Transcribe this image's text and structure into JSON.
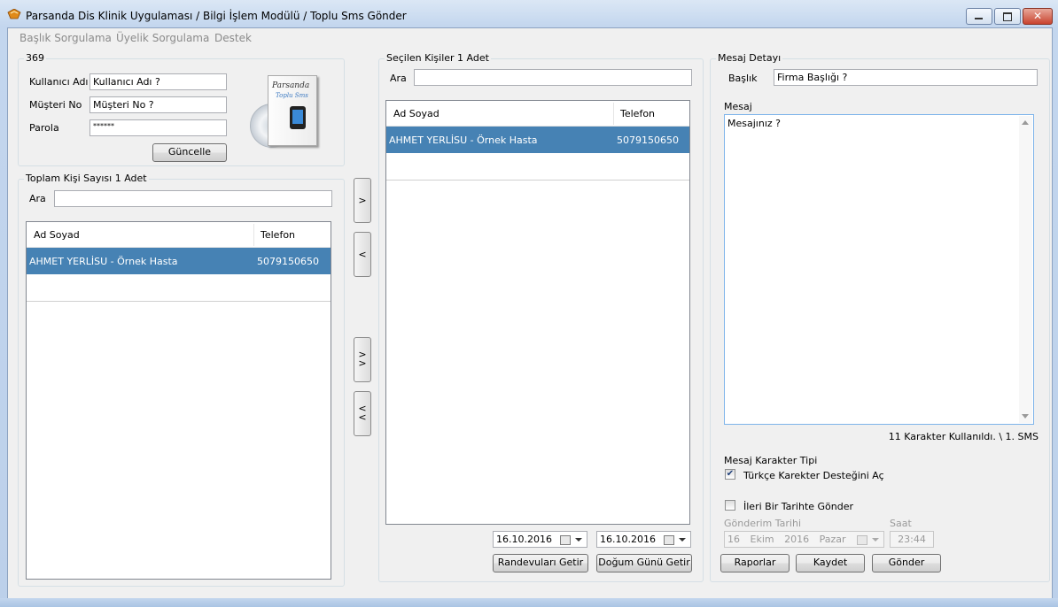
{
  "window": {
    "title": "Parsanda Dis Klinik Uygulaması / Bilgi İşlem Modülü / Toplu Sms Gönder"
  },
  "menu": [
    "Başlık Sorgulama",
    "Üyelik Sorgulama",
    "Destek"
  ],
  "account": {
    "group_title": "369",
    "username_label": "Kullanıcı Adı",
    "username_value": "Kullanıcı Adı ?",
    "customer_label": "Müşteri No",
    "customer_value": "Müşteri No ?",
    "password_label": "Parola",
    "password_value": "******",
    "update_button": "Güncelle",
    "logo_text_1": "Parsanda",
    "logo_text_2": "Toplu Sms"
  },
  "all_people": {
    "group_title": "Toplam Kişi Sayısı 1 Adet",
    "search_label": "Ara",
    "columns": [
      "Ad Soyad",
      "Telefon"
    ],
    "rows": [
      {
        "name": "AHMET YERLİSU  - Örnek Hasta",
        "phone": "5079150650"
      }
    ]
  },
  "move_buttons": {
    "add_one": ">",
    "remove_one": "<",
    "add_all": "> >",
    "remove_all": "< <"
  },
  "selected_people": {
    "group_title": "Seçilen Kişiler 1 Adet",
    "search_label": "Ara",
    "columns": [
      "Ad Soyad",
      "Telefon"
    ],
    "rows": [
      {
        "name": "AHMET YERLİSU  - Örnek Hasta",
        "phone": "5079150650"
      }
    ],
    "date_from": "16.10.2016",
    "date_to": "16.10.2016",
    "appointments_button": "Randevuları Getir",
    "birthday_button": "Doğum Günü Getir"
  },
  "message": {
    "group_title": "Mesaj Detayı",
    "subject_label": "Başlık",
    "subject_value": "Firma Başlığı ?",
    "message_label": "Mesaj",
    "message_value": "Mesajınız ?",
    "char_count": "11 Karakter Kullanıldı. \\ 1. SMS",
    "char_type_label": "Mesaj Karakter Tipi",
    "turkish_support_label": "Türkçe Karekter Desteğini Aç",
    "turkish_support_checked": true,
    "schedule_label": "İleri Bir Tarihte Gönder",
    "schedule_checked": false,
    "send_date_label": "Gönderim Tarihi",
    "send_date": {
      "day": "16",
      "month": "Ekim",
      "year": "2016",
      "weekday": "Pazar"
    },
    "time_label": "Saat",
    "time_value": "23:44",
    "reports_button": "Raporlar",
    "save_button": "Kaydet",
    "send_button": "Gönder"
  },
  "colors": {
    "selection": "#4682b4",
    "window_bg": "#f0f0f0"
  }
}
